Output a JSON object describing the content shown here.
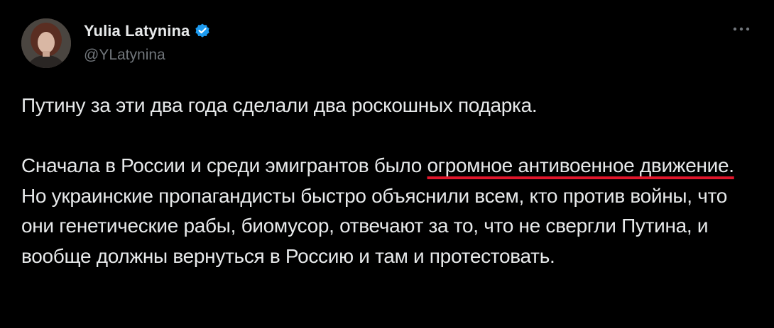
{
  "author": {
    "display_name": "Yulia Latynina",
    "handle": "@YLatynina",
    "verified": true,
    "verified_color": "#1d9bf0"
  },
  "icons": {
    "more": "more-horizontal-icon",
    "verified": "verified-badge-icon"
  },
  "tweet": {
    "paragraph1": "Путину за эти два года сделали два роскошных подарка.",
    "p2_before": "Сначала в России и среди эмигрантов было ",
    "p2_highlight": "огромное антивоенное движение.",
    "p2_after": " Но украинские пропагандисты быстро объяснили всем, кто против войны, что они генетические рабы, биомусор, отвечают за то, что не свергли Путина, и вообще должны вернуться в Россию и там и протестовать.",
    "highlight_color": "#e0162b"
  },
  "colors": {
    "background": "#000000",
    "text": "#e7e9ea",
    "secondary": "#71767b"
  }
}
